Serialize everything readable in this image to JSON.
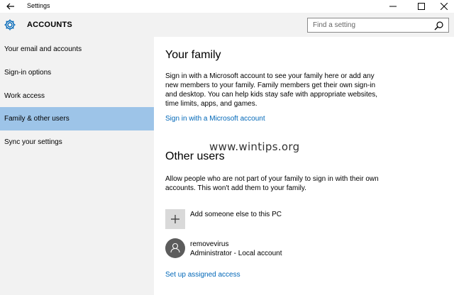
{
  "window": {
    "title": "Settings"
  },
  "header": {
    "title": "ACCOUNTS",
    "search_placeholder": "Find a setting"
  },
  "sidebar": {
    "items": [
      {
        "label": "Your email and accounts"
      },
      {
        "label": "Sign-in options"
      },
      {
        "label": "Work access"
      },
      {
        "label": "Family & other users",
        "selected": true
      },
      {
        "label": "Sync your settings"
      }
    ]
  },
  "family": {
    "title": "Your family",
    "description": "Sign in with a Microsoft account to see your family here or add any new members to your family. Family members get their own sign-in and desktop. You can help kids stay safe with appropriate websites, time limits, apps, and games.",
    "link": "Sign in with a Microsoft account"
  },
  "watermark": "www.wintips.org",
  "other_users": {
    "title": "Other users",
    "description": "Allow people who are not part of your family to sign in with their own accounts. This won't add them to your family.",
    "add_label": "Add someone else to this PC",
    "user": {
      "name": "removevirus",
      "role": "Administrator - Local account"
    },
    "assigned_access_link": "Set up assigned access"
  },
  "colors": {
    "accent": "#0067b8",
    "selected_bg": "#9dc4e8",
    "sidebar_bg": "#f2f2f2"
  },
  "icons": [
    "back-arrow-icon",
    "minimize-icon",
    "maximize-icon",
    "close-icon",
    "gear-icon",
    "search-icon",
    "plus-icon",
    "person-icon"
  ]
}
